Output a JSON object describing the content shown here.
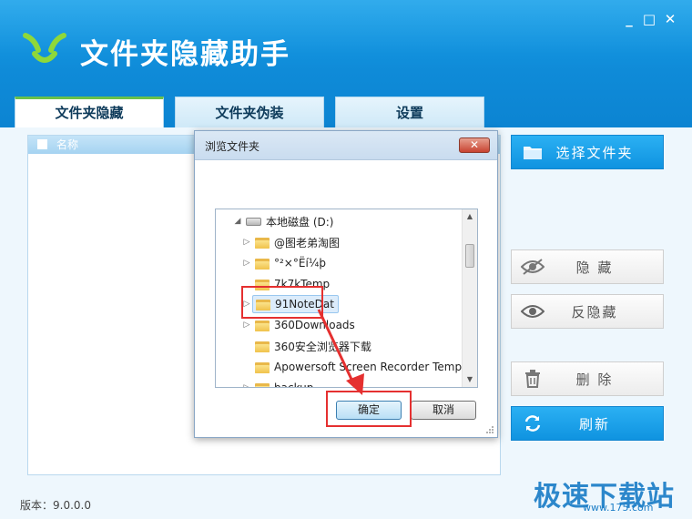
{
  "app": {
    "title": "文件夹隐藏助手",
    "version": "版本：9.0.0.0"
  },
  "window_controls": {
    "minimize": "_",
    "maximize": "□",
    "close": "✕"
  },
  "tabs": [
    {
      "label": "文件夹隐藏",
      "active": true
    },
    {
      "label": "文件夹伪装",
      "active": false
    },
    {
      "label": "设置",
      "active": false
    }
  ],
  "list": {
    "column_name": "名称"
  },
  "actions": {
    "select_folder": "选择文件夹",
    "hide": "隐 藏",
    "unhide": "反隐藏",
    "delete": "删 除",
    "refresh": "刷新"
  },
  "dialog": {
    "title": "浏览文件夹",
    "close_label": "✕",
    "tree": [
      {
        "label": "本地磁盘 (D:)",
        "type": "drive",
        "expanded": true
      },
      {
        "label": "@图老弟淘图",
        "type": "folder",
        "has_children": true
      },
      {
        "label": "°²×°Ëí¼þ",
        "type": "folder",
        "has_children": true
      },
      {
        "label": "7k7kTemp",
        "type": "folder",
        "has_children": false
      },
      {
        "label": "91NoteDat",
        "type": "folder",
        "has_children": true,
        "selected": true
      },
      {
        "label": "360Downloads",
        "type": "folder",
        "has_children": true
      },
      {
        "label": "360安全浏览器下载",
        "type": "folder",
        "has_children": false
      },
      {
        "label": "Apowersoft Screen Recorder Temp",
        "type": "folder",
        "has_children": false
      },
      {
        "label": "backup",
        "type": "folder",
        "has_children": true
      }
    ],
    "ok_label": "确定",
    "cancel_label": "取消"
  },
  "watermark": {
    "text": "极速下载站",
    "url": "www.175.com"
  },
  "colors": {
    "header_blue": "#0f8bd8",
    "accent_green": "#6ac14a",
    "button_blue": "#1a9fe9",
    "highlight_red": "#e53030"
  }
}
